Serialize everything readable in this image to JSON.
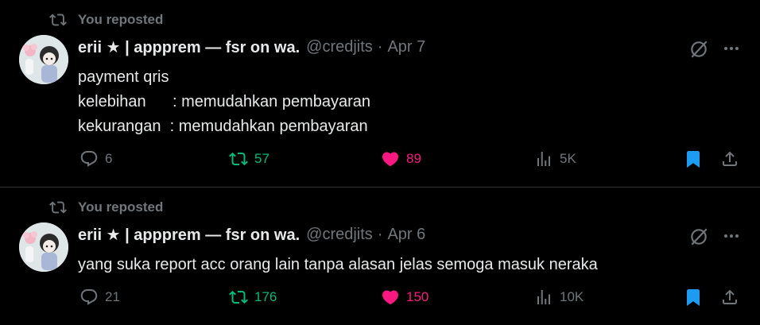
{
  "colors": {
    "background": "#000000",
    "text": "#e7e9ea",
    "muted": "#71767b",
    "repost_green": "#00ba7c",
    "like_pink": "#f91880",
    "bookmark_blue": "#1d9bf0",
    "divider": "#2f3336"
  },
  "tweets": [
    {
      "repost_label": "You reposted",
      "author_name": "erii ★ | appprem — fsr on wa.",
      "handle": "@credjits",
      "separator": "·",
      "date": "Apr 7",
      "text": "payment qris\nkelebihan      : memudahkan pembayaran\nkekurangan  : memudahkan pembayaran",
      "replies": "6",
      "reposts": "57",
      "likes": "89",
      "views": "5K",
      "icons": {
        "reply": "reply-icon",
        "repost": "repost-icon",
        "like": "heart-filled-icon",
        "views": "views-icon",
        "bookmark": "bookmark-filled-icon",
        "share": "share-icon",
        "grok": "grok-icon",
        "more": "more-icon"
      }
    },
    {
      "repost_label": "You reposted",
      "author_name": "erii ★ | appprem — fsr on wa.",
      "handle": "@credjits",
      "separator": "·",
      "date": "Apr 6",
      "text": "yang suka report acc orang lain tanpa alasan jelas semoga masuk neraka",
      "replies": "21",
      "reposts": "176",
      "likes": "150",
      "views": "10K",
      "icons": {
        "reply": "reply-icon",
        "repost": "repost-icon",
        "like": "heart-filled-icon",
        "views": "views-icon",
        "bookmark": "bookmark-filled-icon",
        "share": "share-icon",
        "grok": "grok-icon",
        "more": "more-icon"
      }
    }
  ]
}
